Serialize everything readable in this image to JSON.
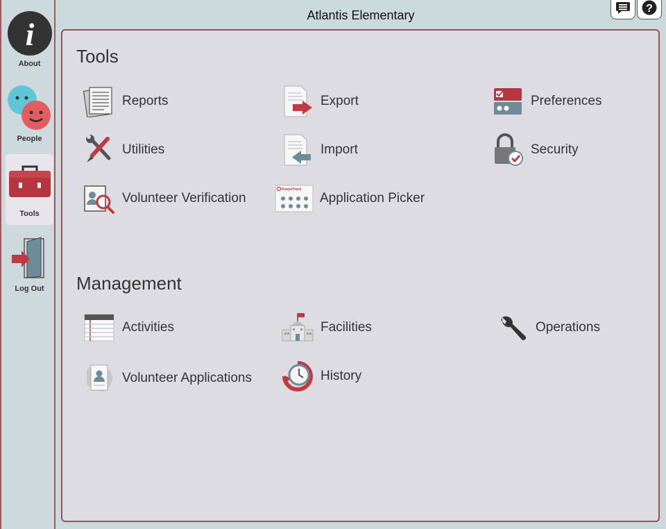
{
  "window": {
    "title": "Atlantis Elementary"
  },
  "sidebar": {
    "items": [
      {
        "label": "About",
        "icon": "info-icon"
      },
      {
        "label": "People",
        "icon": "people-icon"
      },
      {
        "label": "Tools",
        "icon": "toolbox-icon",
        "active": true
      },
      {
        "label": "Log Out",
        "icon": "logout-door-icon"
      }
    ]
  },
  "top_buttons": [
    {
      "icon": "chat-icon"
    },
    {
      "icon": "help-icon"
    }
  ],
  "tools_section": {
    "title": "Tools",
    "items": [
      {
        "label": "Reports",
        "icon": "reports-icon"
      },
      {
        "label": "Export",
        "icon": "export-icon"
      },
      {
        "label": "Preferences",
        "icon": "preferences-icon"
      },
      {
        "label": "Utilities",
        "icon": "utilities-icon"
      },
      {
        "label": "Import",
        "icon": "import-icon"
      },
      {
        "label": "Security",
        "icon": "security-lock-icon"
      },
      {
        "label": "Volunteer Verification",
        "icon": "volunteer-verification-icon"
      },
      {
        "label": "Application Picker",
        "icon": "application-picker-icon",
        "icon_text": "KeepnTrack"
      }
    ]
  },
  "management_section": {
    "title": "Management",
    "items": [
      {
        "label": "Activities",
        "icon": "activities-notepad-icon"
      },
      {
        "label": "Facilities",
        "icon": "facilities-building-icon"
      },
      {
        "label": "Operations",
        "icon": "operations-wrench-icon"
      },
      {
        "label": "Volunteer Applications",
        "icon": "volunteer-applications-icon"
      },
      {
        "label": "History",
        "icon": "history-clock-icon"
      }
    ]
  },
  "colors": {
    "accent": "#9c4f55",
    "panel_bg": "#dddce2",
    "sidebar_bg": "#cdd9dc"
  }
}
